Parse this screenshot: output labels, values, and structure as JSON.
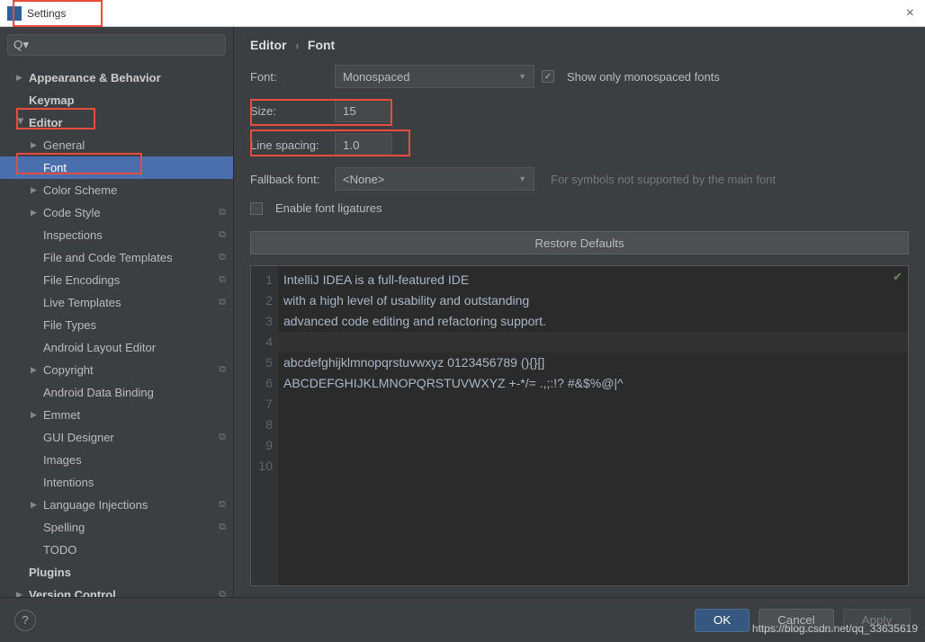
{
  "window": {
    "title": "Settings"
  },
  "search": {
    "placeholder": ""
  },
  "breadcrumb": {
    "root": "Editor",
    "child": "Font"
  },
  "tree": [
    {
      "label": "Appearance & Behavior",
      "bold": true,
      "arrow": "closed",
      "indent": 0
    },
    {
      "label": "Keymap",
      "bold": true,
      "indent": 0
    },
    {
      "label": "Editor",
      "bold": true,
      "arrow": "open",
      "indent": 0
    },
    {
      "label": "General",
      "arrow": "closed",
      "indent": 1
    },
    {
      "label": "Font",
      "indent": 1,
      "selected": true
    },
    {
      "label": "Color Scheme",
      "arrow": "closed",
      "indent": 1
    },
    {
      "label": "Code Style",
      "arrow": "closed",
      "indent": 1,
      "copy": true
    },
    {
      "label": "Inspections",
      "indent": 1,
      "copy": true
    },
    {
      "label": "File and Code Templates",
      "indent": 1,
      "copy": true
    },
    {
      "label": "File Encodings",
      "indent": 1,
      "copy": true
    },
    {
      "label": "Live Templates",
      "indent": 1,
      "copy": true
    },
    {
      "label": "File Types",
      "indent": 1
    },
    {
      "label": "Android Layout Editor",
      "indent": 1
    },
    {
      "label": "Copyright",
      "arrow": "closed",
      "indent": 1,
      "copy": true
    },
    {
      "label": "Android Data Binding",
      "indent": 1
    },
    {
      "label": "Emmet",
      "arrow": "closed",
      "indent": 1
    },
    {
      "label": "GUI Designer",
      "indent": 1,
      "copy": true
    },
    {
      "label": "Images",
      "indent": 1
    },
    {
      "label": "Intentions",
      "indent": 1
    },
    {
      "label": "Language Injections",
      "arrow": "closed",
      "indent": 1,
      "copy": true
    },
    {
      "label": "Spelling",
      "indent": 1,
      "copy": true
    },
    {
      "label": "TODO",
      "indent": 1
    },
    {
      "label": "Plugins",
      "bold": true,
      "indent": 0
    },
    {
      "label": "Version Control",
      "bold": true,
      "arrow": "closed",
      "indent": 0,
      "copy": true
    }
  ],
  "form": {
    "font_label": "Font:",
    "font_value": "Monospaced",
    "mono_label": "Show only monospaced fonts",
    "size_label": "Size:",
    "size_value": "15",
    "spacing_label": "Line spacing:",
    "spacing_value": "1.0",
    "fallback_label": "Fallback font:",
    "fallback_value": "<None>",
    "fallback_hint": "For symbols not supported by the main font",
    "ligatures_label": "Enable font ligatures",
    "restore_label": "Restore Defaults"
  },
  "preview": {
    "lines": [
      "IntelliJ IDEA is a full-featured IDE",
      "with a high level of usability and outstanding",
      "advanced code editing and refactoring support.",
      "",
      "abcdefghijklmnopqrstuvwxyz 0123456789 (){}[]",
      "ABCDEFGHIJKLMNOPQRSTUVWXYZ +-*/= .,;:!? #&$%@|^",
      "",
      "",
      "",
      ""
    ]
  },
  "buttons": {
    "ok": "OK",
    "cancel": "Cancel",
    "apply": "Apply"
  },
  "watermark": "https://blog.csdn.net/qq_33635619"
}
